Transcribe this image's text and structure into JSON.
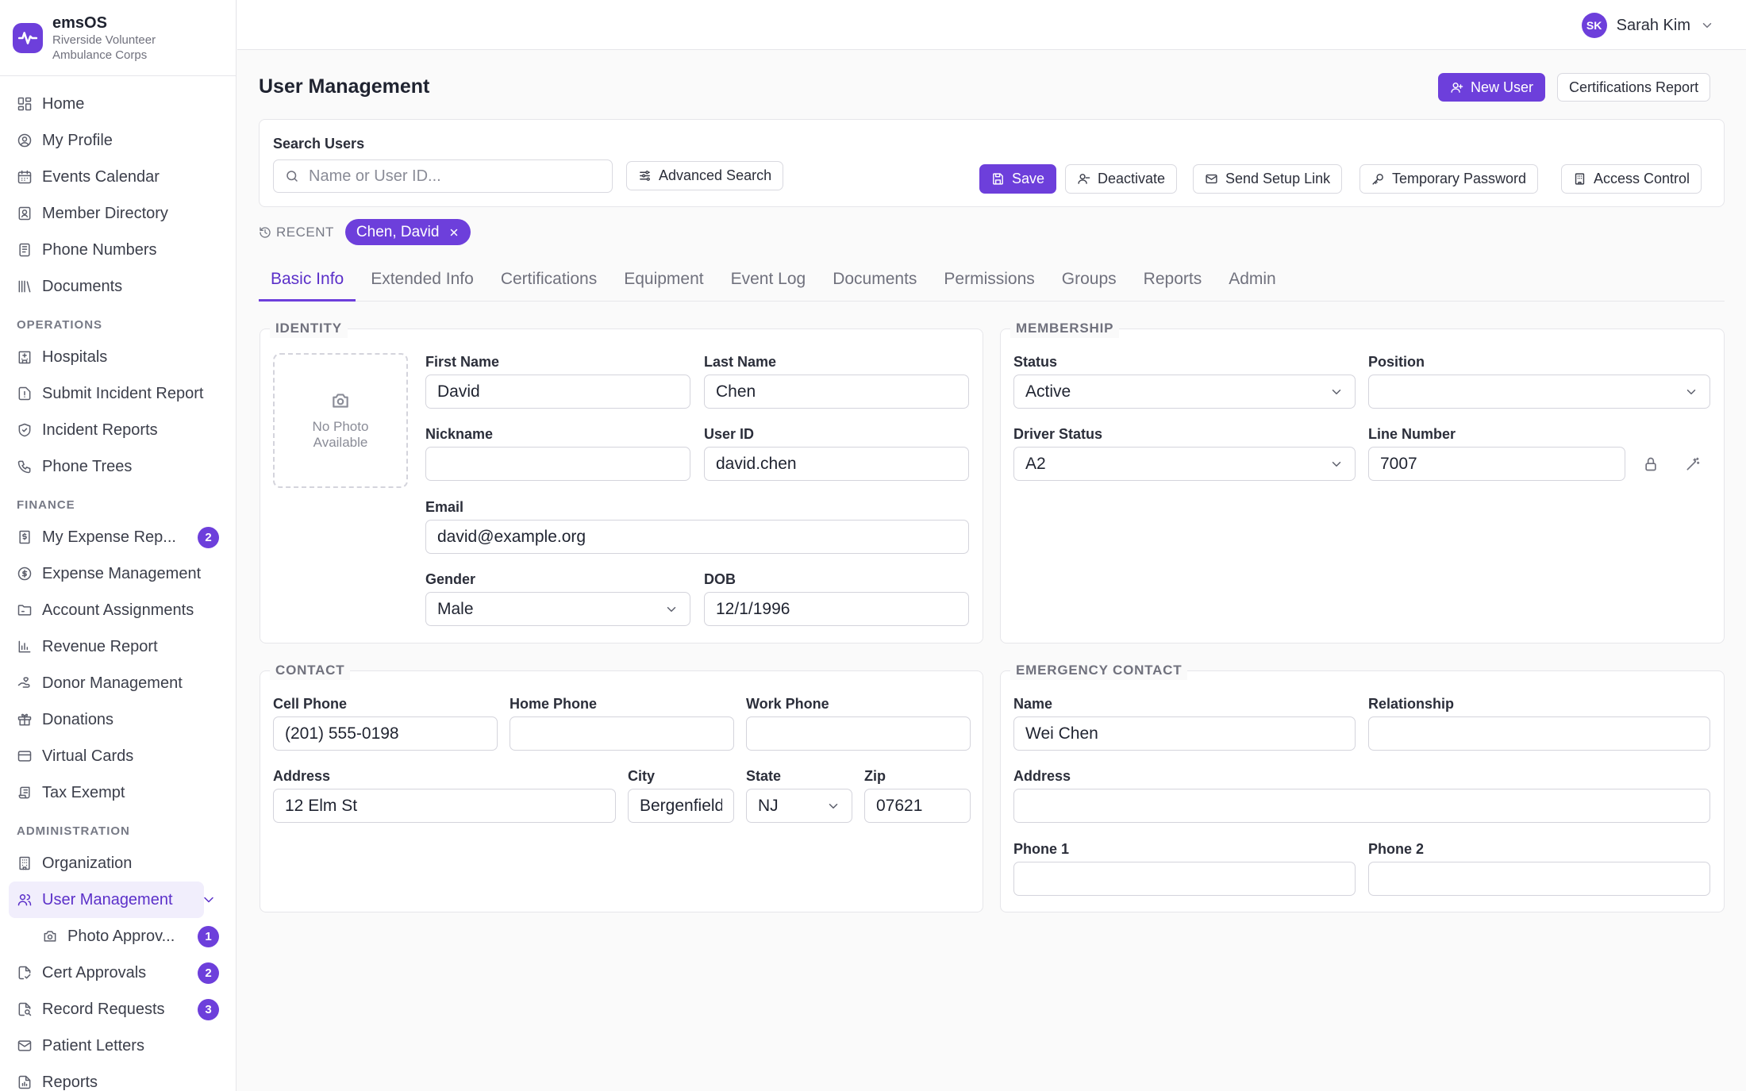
{
  "brand": {
    "name": "emsOS",
    "org": "Riverside Volunteer Ambulance Corps"
  },
  "nav": {
    "items": [
      {
        "label": "Home",
        "icon": "home-icon"
      },
      {
        "label": "My Profile",
        "icon": "user-circle-icon"
      },
      {
        "label": "Events Calendar",
        "icon": "calendar-icon"
      },
      {
        "label": "Member Directory",
        "icon": "contacts-icon"
      },
      {
        "label": "Phone Numbers",
        "icon": "phone-book-icon"
      },
      {
        "label": "Documents",
        "icon": "library-icon"
      }
    ],
    "operations_label": "OPERATIONS",
    "operations": [
      {
        "label": "Hospitals",
        "icon": "hospital-icon"
      },
      {
        "label": "Submit Incident Report",
        "icon": "alert-file-icon"
      },
      {
        "label": "Incident Reports",
        "icon": "shield-icon"
      },
      {
        "label": "Phone Trees",
        "icon": "phone-icon"
      }
    ],
    "finance_label": "FINANCE",
    "finance": [
      {
        "label": "My Expense Rep...",
        "icon": "receipt-icon",
        "badge": "2"
      },
      {
        "label": "Expense Management",
        "icon": "dollar-icon"
      },
      {
        "label": "Account Assignments",
        "icon": "folder-icon"
      },
      {
        "label": "Revenue Report",
        "icon": "bar-chart-icon"
      },
      {
        "label": "Donor Management",
        "icon": "hand-heart-icon"
      },
      {
        "label": "Donations",
        "icon": "gift-icon"
      },
      {
        "label": "Virtual Cards",
        "icon": "credit-card-icon"
      },
      {
        "label": "Tax Exempt",
        "icon": "scroll-icon"
      }
    ],
    "administration_label": "ADMINISTRATION",
    "administration": [
      {
        "label": "Organization",
        "icon": "building-icon"
      },
      {
        "label": "User Management",
        "icon": "users-icon"
      },
      {
        "label": "Photo Approv...",
        "icon": "camera-icon",
        "badge": "1"
      },
      {
        "label": "Cert Approvals",
        "icon": "file-check-icon",
        "badge": "2"
      },
      {
        "label": "Record Requests",
        "icon": "file-search-icon",
        "badge": "3"
      },
      {
        "label": "Patient Letters",
        "icon": "mail-icon"
      },
      {
        "label": "Reports",
        "icon": "file-chart-icon"
      }
    ]
  },
  "user": {
    "initials": "SK",
    "name": "Sarah Kim"
  },
  "page": {
    "title": "User Management",
    "new_user": "New User",
    "cert_report": "Certifications Report"
  },
  "search": {
    "label": "Search Users",
    "placeholder": "Name or User ID...",
    "advanced": "Advanced Search",
    "save": "Save",
    "deactivate": "Deactivate",
    "send_setup": "Send Setup Link",
    "temp_password": "Temporary Password",
    "access_control": "Access Control"
  },
  "recent": {
    "label": "RECENT",
    "chip": "Chen, David"
  },
  "tabs": [
    "Basic Info",
    "Extended Info",
    "Certifications",
    "Equipment",
    "Event Log",
    "Documents",
    "Permissions",
    "Groups",
    "Reports",
    "Admin"
  ],
  "identity": {
    "legend": "IDENTITY",
    "photo_text": "No Photo Available",
    "first_name": {
      "label": "First Name",
      "value": "David"
    },
    "last_name": {
      "label": "Last Name",
      "value": "Chen"
    },
    "nickname": {
      "label": "Nickname",
      "value": ""
    },
    "user_id": {
      "label": "User ID",
      "value": "david.chen"
    },
    "email": {
      "label": "Email",
      "value": "david@example.org"
    },
    "gender": {
      "label": "Gender",
      "value": "Male"
    },
    "dob": {
      "label": "DOB",
      "value": "12/1/1996"
    }
  },
  "membership": {
    "legend": "MEMBERSHIP",
    "status": {
      "label": "Status",
      "value": "Active"
    },
    "position": {
      "label": "Position",
      "value": ""
    },
    "driver_status": {
      "label": "Driver Status",
      "value": "A2"
    },
    "line_number": {
      "label": "Line Number",
      "value": "7007"
    }
  },
  "contact": {
    "legend": "CONTACT",
    "cell": {
      "label": "Cell Phone",
      "value": "(201) 555-0198"
    },
    "home": {
      "label": "Home Phone",
      "value": ""
    },
    "work": {
      "label": "Work Phone",
      "value": ""
    },
    "address": {
      "label": "Address",
      "value": "12 Elm St"
    },
    "city": {
      "label": "City",
      "value": "Bergenfield"
    },
    "state": {
      "label": "State",
      "value": "NJ"
    },
    "zip": {
      "label": "Zip",
      "value": "07621"
    }
  },
  "emergency": {
    "legend": "EMERGENCY CONTACT",
    "name": {
      "label": "Name",
      "value": "Wei Chen"
    },
    "relationship": {
      "label": "Relationship",
      "value": ""
    },
    "address": {
      "label": "Address",
      "value": ""
    },
    "phone1": {
      "label": "Phone 1",
      "value": ""
    },
    "phone2": {
      "label": "Phone 2",
      "value": ""
    }
  },
  "colors": {
    "accent": "#6d3fdb",
    "accent_text": "#5b30c9",
    "border": "#e6e6ea"
  }
}
